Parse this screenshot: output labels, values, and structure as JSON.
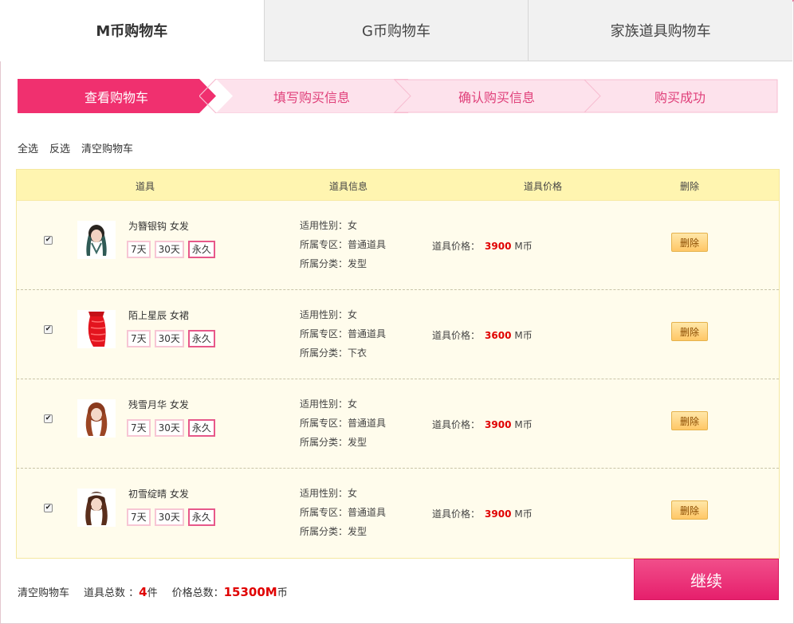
{
  "tabs": [
    {
      "label": "M币购物车",
      "active": true
    },
    {
      "label": "G币购物车",
      "active": false
    },
    {
      "label": "家族道具购物车",
      "active": false
    }
  ],
  "steps": [
    {
      "label": "查看购物车",
      "active": true
    },
    {
      "label": "填写购买信息",
      "active": false
    },
    {
      "label": "确认购买信息",
      "active": false
    },
    {
      "label": "购买成功",
      "active": false
    }
  ],
  "actions": {
    "select_all": "全选",
    "invert": "反选",
    "clear": "清空购物车"
  },
  "table": {
    "headers": [
      "道具",
      "道具信息",
      "道具价格",
      "删除"
    ],
    "price_label": "道具价格：",
    "currency": "M币",
    "delete_label": "删除",
    "durations": [
      "7天",
      "30天",
      "永久"
    ],
    "info_labels": {
      "gender": "适用性别：",
      "zone": "所属专区：",
      "category": "所属分类："
    },
    "items": [
      {
        "name": "为簪银钩 女发",
        "gender": "女",
        "zone": "普通道具",
        "category": "发型",
        "price": "3900",
        "thumb_icon": "hair-dark-icon"
      },
      {
        "name": "陌上星辰 女裙",
        "gender": "女",
        "zone": "普通道具",
        "category": "下衣",
        "price": "3600",
        "thumb_icon": "red-skirt-icon"
      },
      {
        "name": "残雪月华 女发",
        "gender": "女",
        "zone": "普通道具",
        "category": "发型",
        "price": "3900",
        "thumb_icon": "hair-brown-icon"
      },
      {
        "name": "初雪绽晴 女发",
        "gender": "女",
        "zone": "普通道具",
        "category": "发型",
        "price": "3900",
        "thumb_icon": "hair-headband-icon"
      }
    ]
  },
  "footer": {
    "clear": "清空购物车",
    "count_label": "道具总数 ：",
    "count_value": "4",
    "count_unit": "件",
    "total_label": "价格总数：",
    "total_value": "15300M",
    "total_unit": "币"
  },
  "continue_label": "继续",
  "colors": {
    "accent": "#f0306f",
    "accent_light": "#fde2ec",
    "price": "#e00000",
    "table_header": "#fff5b0"
  }
}
